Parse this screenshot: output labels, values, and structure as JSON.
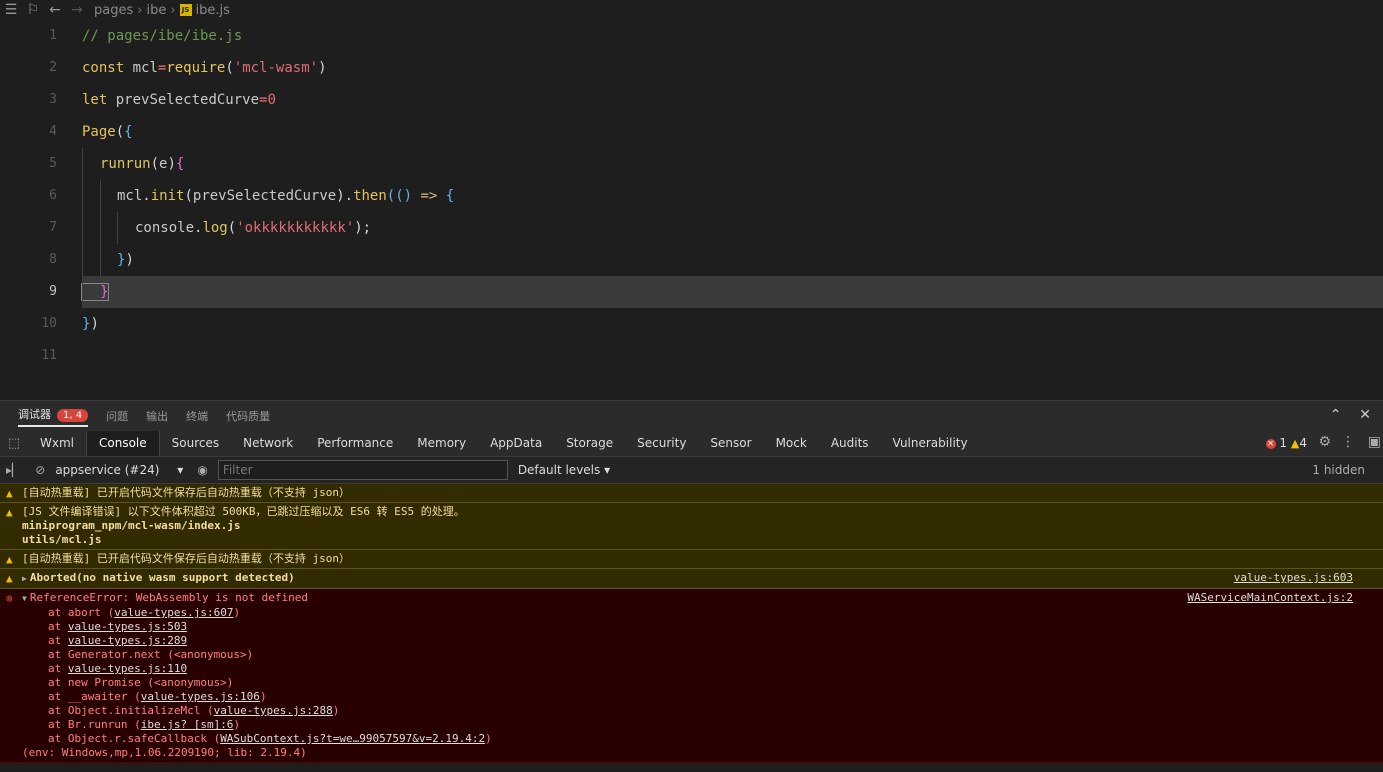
{
  "breadcrumb": {
    "seg1": "pages",
    "seg2": "ibe",
    "file": "ibe.js",
    "badge": "JS"
  },
  "editor": {
    "line_numbers": [
      "1",
      "2",
      "3",
      "4",
      "5",
      "6",
      "7",
      "8",
      "9",
      "10",
      "11"
    ],
    "current_line": "9",
    "code": {
      "l1": "// pages/ibe/ibe.js",
      "l2_kw": "const",
      "l2_var": " mcl",
      "l2_op": "=",
      "l2_fn": "require",
      "l2_open": "(",
      "l2_str": "'mcl-wasm'",
      "l2_close": ")",
      "l3_kw": "let",
      "l3_var": " prevSelectedCurve",
      "l3_op": "=",
      "l3_num": "0",
      "l4_fn": "Page",
      "l4_p": "(",
      "l4_b": "{",
      "l5_fn": "runrun",
      "l5_p": "(",
      "l5_arg": "e",
      "l5_pc": ")",
      "l5_b": "{",
      "l6_var": "mcl",
      "l6_dot": ".",
      "l6_fn": "init",
      "l6_p": "(",
      "l6_arg": "prevSelectedCurve",
      "l6_pc": ")",
      "l6_dot2": ".",
      "l6_fn2": "then",
      "l6_p2": "((",
      "l6_p3": ") ",
      "l6_arrow": "=>",
      "l6_b": " {",
      "l7_var": "console",
      "l7_dot": ".",
      "l7_fn": "log",
      "l7_p": "(",
      "l7_str": "'okkkkkkkkkkk'",
      "l7_pc": ");",
      "l8_b": "}",
      "l8_p": ")",
      "l9_b": "}",
      "l10_b": "}",
      "l10_p": ")"
    }
  },
  "panel_tabs": {
    "debugger": "调试器",
    "debugger_badge": "1, 4",
    "problems": "问题",
    "output": "输出",
    "terminal": "终端",
    "code_quality": "代码质量"
  },
  "devtools_tabs": [
    "Wxml",
    "Console",
    "Sources",
    "Network",
    "Performance",
    "Memory",
    "AppData",
    "Storage",
    "Security",
    "Sensor",
    "Mock",
    "Audits",
    "Vulnerability"
  ],
  "devtools_active": "Console",
  "counts": {
    "errors": "1",
    "warnings": "4"
  },
  "filterbar": {
    "context": "appservice (#24)",
    "filter_placeholder": "Filter",
    "levels": "Default levels ▾",
    "hidden": "1 hidden"
  },
  "messages": {
    "w1": "[自动热重载] 已开启代码文件保存后自动热重载（不支持 json）",
    "w2_line1": "[JS 文件编译错误] 以下文件体积超过 500KB，已跳过压缩以及 ES6 转 ES5 的处理。",
    "w2_line2": "miniprogram_npm/mcl-wasm/index.js",
    "w2_line3": "utils/mcl.js",
    "w3": "[自动热重载] 已开启代码文件保存后自动热重载（不支持 json）",
    "w4": "Aborted(no native wasm support detected)",
    "w4_src": "value-types.js:603",
    "e1": "ReferenceError: WebAssembly is not defined",
    "e1_src": "WAServiceMainContext.js:2",
    "frames": {
      "f1_pre": "at abort (",
      "f1_link": "value-types.js:607",
      "f1_post": ")",
      "f2_pre": "at ",
      "f2_link": "value-types.js:503",
      "f3_pre": "at ",
      "f3_link": "value-types.js:289",
      "f4": "at Generator.next (<anonymous>)",
      "f5_pre": "at ",
      "f5_link": "value-types.js:110",
      "f6": "at new Promise (<anonymous>)",
      "f7_pre": "at __awaiter (",
      "f7_link": "value-types.js:106",
      "f7_post": ")",
      "f8_pre": "at Object.initializeMcl (",
      "f8_link": "value-types.js:288",
      "f8_post": ")",
      "f9_pre": "at Br.runrun (",
      "f9_link": "ibe.js? [sm]:6",
      "f9_post": ")",
      "f10_pre": "at Object.r.safeCallback (",
      "f10_link": "WASubContext.js?t=we…99057597&v=2.19.4:2",
      "f10_post": ")"
    },
    "env": "(env: Windows,mp,1.06.2209190; lib: 2.19.4)"
  }
}
